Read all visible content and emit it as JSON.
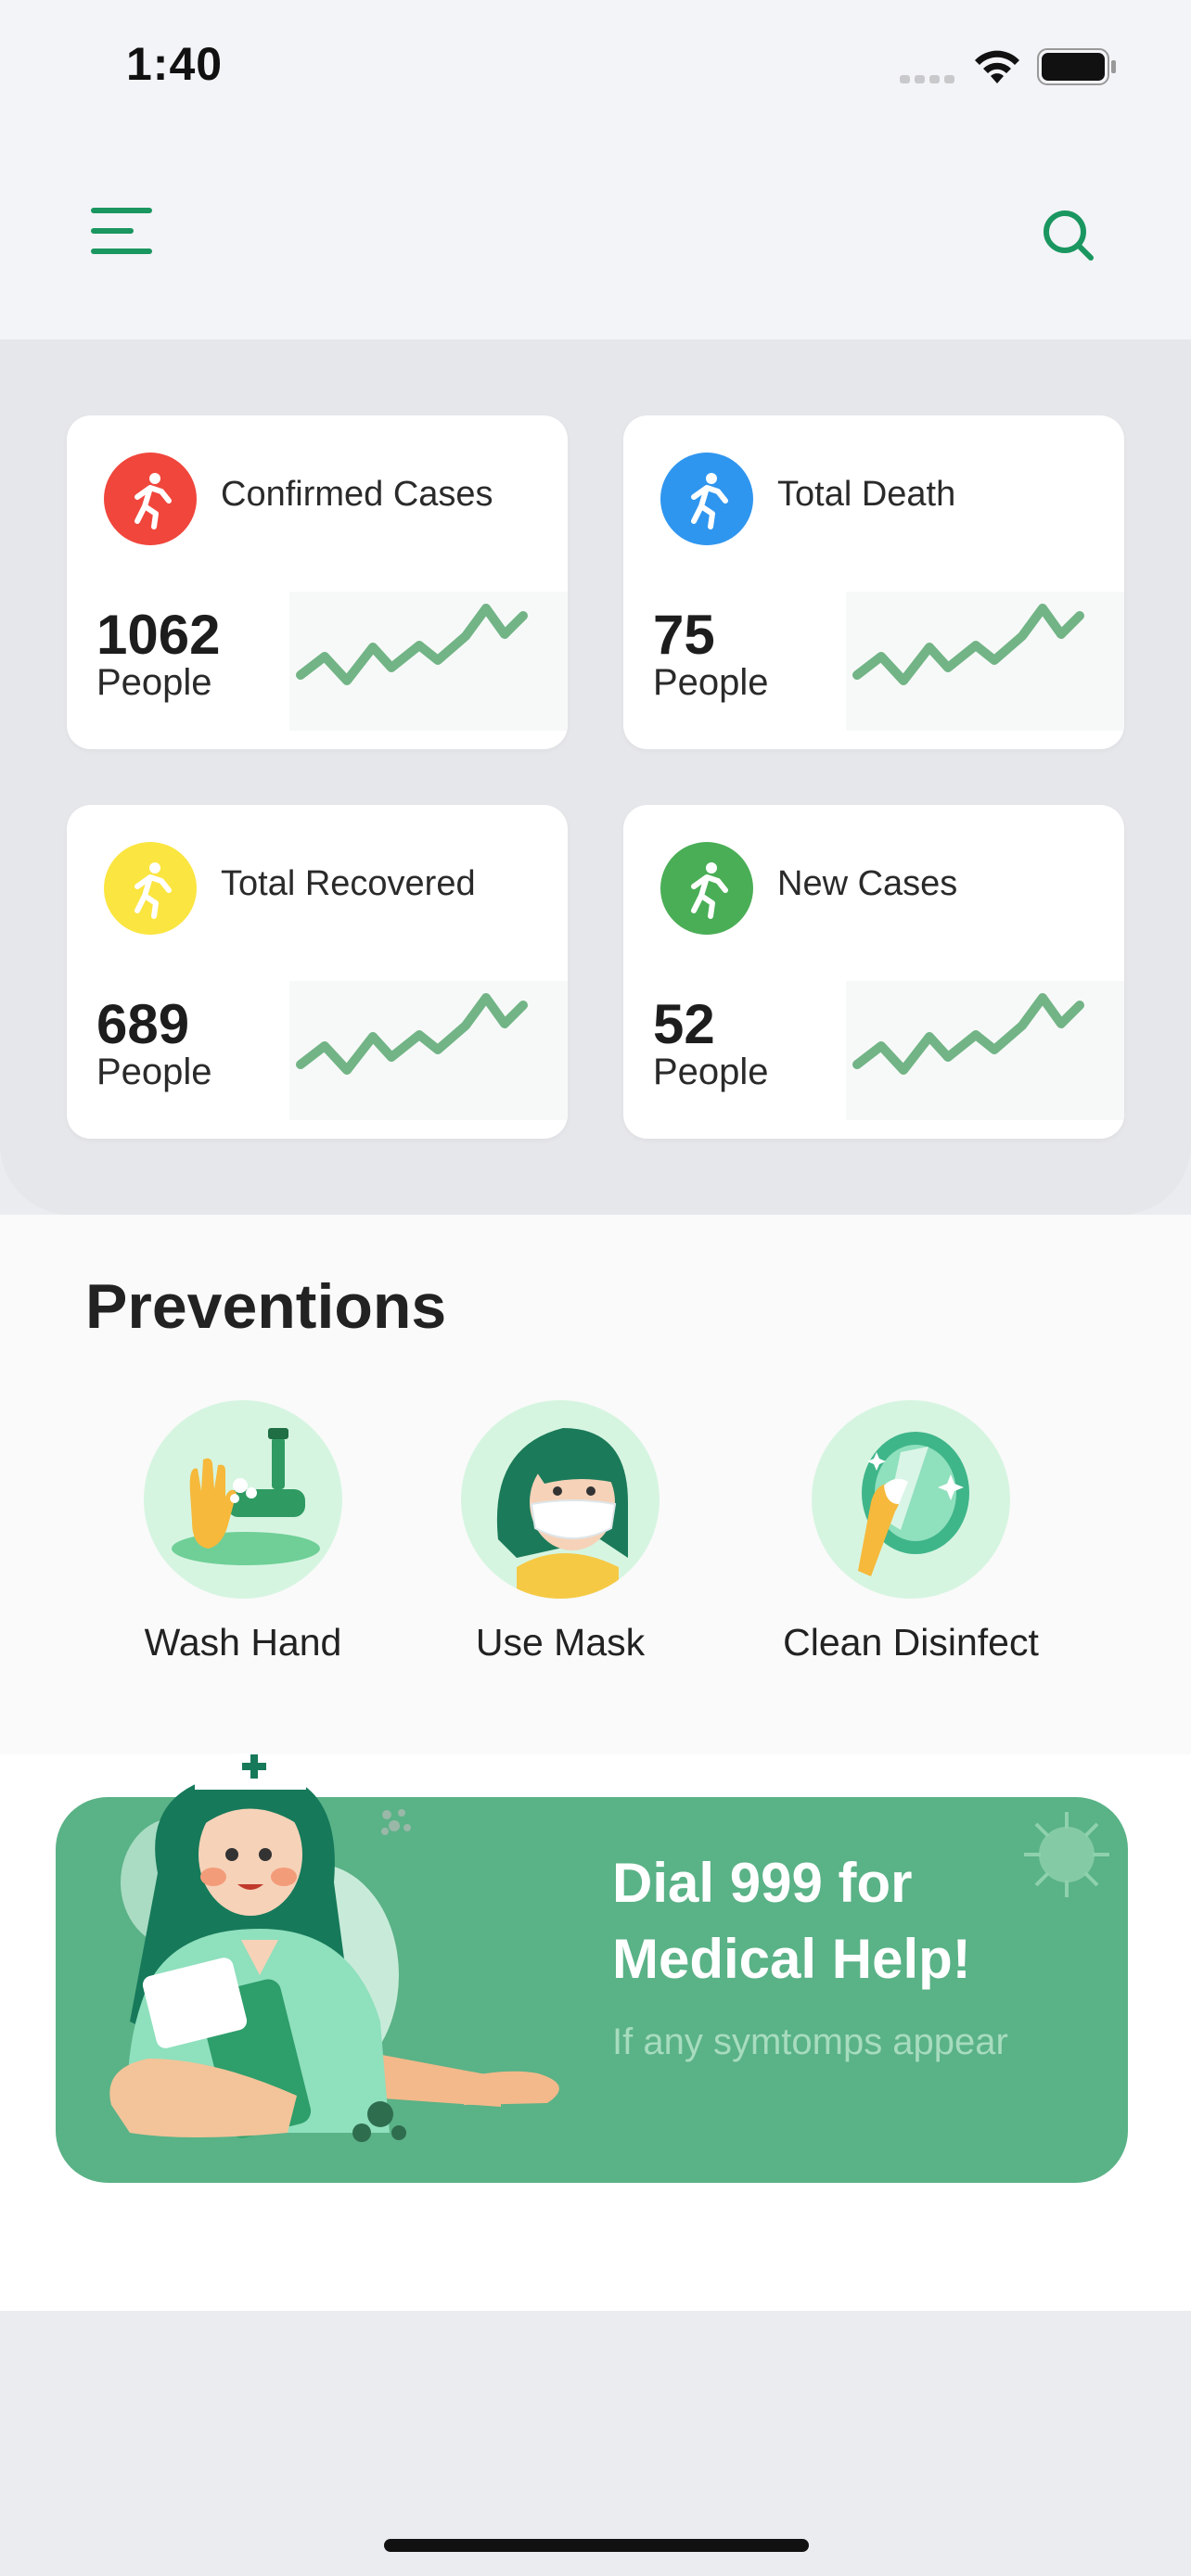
{
  "status_bar": {
    "time": "1:40"
  },
  "header": {
    "menu_icon": "hamburger-menu-icon",
    "search_icon": "search-icon",
    "accent_color": "#1a9660"
  },
  "stats": [
    {
      "title": "Confirmed Cases",
      "value": "1062",
      "unit": "People",
      "badge_color": "#f0463c",
      "icon": "running-person-icon"
    },
    {
      "title": "Total Death",
      "value": "75",
      "unit": "People",
      "badge_color": "#2f96ef",
      "icon": "running-person-icon"
    },
    {
      "title": "Total Recovered",
      "value": "689",
      "unit": "People",
      "badge_color": "#fbe540",
      "icon": "running-person-icon"
    },
    {
      "title": "New Cases",
      "value": "52",
      "unit": "People",
      "badge_color": "#4aae56",
      "icon": "running-person-icon"
    }
  ],
  "preventions": {
    "title": "Preventions",
    "items": [
      {
        "label": "Wash Hand",
        "icon": "wash-hand-icon"
      },
      {
        "label": "Use Mask",
        "icon": "use-mask-icon"
      },
      {
        "label": "Clean Disinfect",
        "icon": "clean-disinfect-icon"
      }
    ]
  },
  "banner": {
    "title": "Dial 999 for Medical Help!",
    "subtitle": "If any symtomps appear",
    "background_color": "#5ab287"
  }
}
